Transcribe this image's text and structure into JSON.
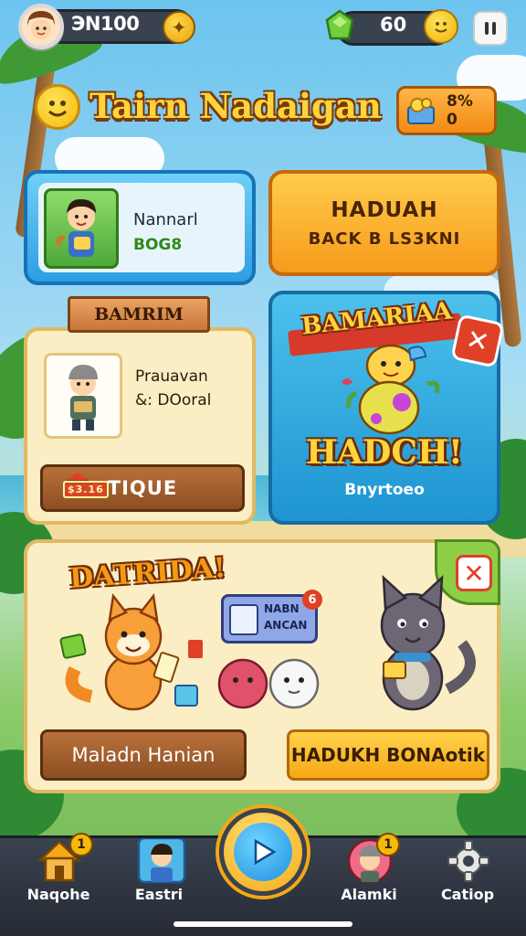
{
  "top_bar": {
    "coins": "ЭN100",
    "gems": "60",
    "coin_icon": "coin-plus-icon",
    "gem_icon": "green-gem-icon",
    "menu_icon": "pause-menu-icon"
  },
  "title": {
    "text": "Tairn Nadaigan",
    "stat_line1": "8%",
    "stat_line2": "0"
  },
  "profile_card": {
    "name": "Nannarl",
    "sub": "BOG8"
  },
  "orange_card": {
    "line1": "HADUAH",
    "line2": "BACK B LS3KNI"
  },
  "cream_card": {
    "ribbon": "BAMRIM",
    "line1": "Prauavan",
    "line2": "&: DOoral",
    "price_tag": "$3.16",
    "button": "TIQUE"
  },
  "hatch_card": {
    "banner": "BAMARIAA",
    "title": "HADCH!",
    "subtitle": "Bnyrtoeo"
  },
  "promo_card": {
    "headline": "DATRIDA!",
    "name_card_line1": "NABN",
    "name_card_line2": "ANCAN",
    "name_card_number": "6",
    "left_button": "Maladn Hanian",
    "right_button": "HADUKH BONAotik"
  },
  "bottom_nav": {
    "items": [
      {
        "label": "Naqohe",
        "badge": "1"
      },
      {
        "label": "Eastri",
        "badge": ""
      },
      {
        "label": "Alamki",
        "badge": "1"
      },
      {
        "label": "Catiop",
        "badge": ""
      }
    ]
  },
  "colors": {
    "accent_gold": "#f4a814",
    "panel_cream": "#fbedc4",
    "panel_blue": "#2e9ee3",
    "nav_dark": "#3a4250"
  }
}
